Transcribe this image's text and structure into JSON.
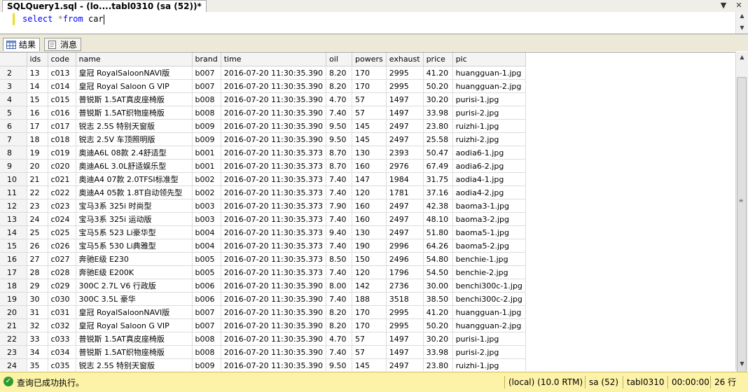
{
  "doc_tab": {
    "title": "SQLQuery1.sql - (lo....tabl0310 (sa (52))*"
  },
  "editor": {
    "kw_select": "select",
    "op_star": "*",
    "kw_from": "from",
    "table": "car"
  },
  "result_tabs": [
    {
      "label": "结果"
    },
    {
      "label": "消息"
    }
  ],
  "grid": {
    "columns": [
      "ids",
      "code",
      "name",
      "brand",
      "time",
      "oil",
      "powers",
      "exhaust",
      "price",
      "pic"
    ],
    "rows": [
      [
        "2",
        "13",
        "c013",
        "皇冠 RoyalSaloonNAVI版",
        "b007",
        "2016-07-20 11:30:35.390",
        "8.20",
        "170",
        "2995",
        "41.20",
        "huangguan-1.jpg"
      ],
      [
        "3",
        "14",
        "c014",
        "皇冠 Royal Saloon G VIP",
        "b007",
        "2016-07-20 11:30:35.390",
        "8.20",
        "170",
        "2995",
        "50.20",
        "huangguan-2.jpg"
      ],
      [
        "4",
        "15",
        "c015",
        "普锐斯 1.5AT真皮座椅版",
        "b008",
        "2016-07-20 11:30:35.390",
        "4.70",
        "57",
        "1497",
        "30.20",
        "purisi-1.jpg"
      ],
      [
        "5",
        "16",
        "c016",
        "普锐斯 1.5AT织物座椅版",
        "b008",
        "2016-07-20 11:30:35.390",
        "7.40",
        "57",
        "1497",
        "33.98",
        "purisi-2.jpg"
      ],
      [
        "6",
        "17",
        "c017",
        "锐志 2.5S 特别天窗版",
        "b009",
        "2016-07-20 11:30:35.390",
        "9.50",
        "145",
        "2497",
        "23.80",
        "ruizhi-1.jpg"
      ],
      [
        "7",
        "18",
        "c018",
        "锐志 2.5V 车顶照明版",
        "b009",
        "2016-07-20 11:30:35.390",
        "9.50",
        "145",
        "2497",
        "25.58",
        "ruizhi-2.jpg"
      ],
      [
        "8",
        "19",
        "c019",
        "奥迪A6L 08款 2.4舒适型",
        "b001",
        "2016-07-20 11:30:35.373",
        "8.70",
        "130",
        "2393",
        "50.47",
        "aodia6-1.jpg"
      ],
      [
        "9",
        "20",
        "c020",
        "奥迪A6L 3.0L舒适娱乐型",
        "b001",
        "2016-07-20 11:30:35.373",
        "8.70",
        "160",
        "2976",
        "67.49",
        "aodia6-2.jpg"
      ],
      [
        "10",
        "21",
        "c021",
        "奥迪A4 07款 2.0TFSI标准型",
        "b002",
        "2016-07-20 11:30:35.373",
        "7.40",
        "147",
        "1984",
        "31.75",
        "aodia4-1.jpg"
      ],
      [
        "11",
        "22",
        "c022",
        "奥迪A4 05款 1.8T自动领先型",
        "b002",
        "2016-07-20 11:30:35.373",
        "7.40",
        "120",
        "1781",
        "37.16",
        "aodia4-2.jpg"
      ],
      [
        "12",
        "23",
        "c023",
        "宝马3系 325i 时尚型",
        "b003",
        "2016-07-20 11:30:35.373",
        "7.90",
        "160",
        "2497",
        "42.38",
        "baoma3-1.jpg"
      ],
      [
        "13",
        "24",
        "c024",
        "宝马3系 325i 运动版",
        "b003",
        "2016-07-20 11:30:35.373",
        "7.40",
        "160",
        "2497",
        "48.10",
        "baoma3-2.jpg"
      ],
      [
        "14",
        "25",
        "c025",
        "宝马5系 523 Li豪华型",
        "b004",
        "2016-07-20 11:30:35.373",
        "9.40",
        "130",
        "2497",
        "51.80",
        "baoma5-1.jpg"
      ],
      [
        "15",
        "26",
        "c026",
        "宝马5系 530 Li典雅型",
        "b004",
        "2016-07-20 11:30:35.373",
        "7.40",
        "190",
        "2996",
        "64.26",
        "baoma5-2.jpg"
      ],
      [
        "16",
        "27",
        "c027",
        "奔驰E级 E230",
        "b005",
        "2016-07-20 11:30:35.373",
        "8.50",
        "150",
        "2496",
        "54.80",
        "benchie-1.jpg"
      ],
      [
        "17",
        "28",
        "c028",
        "奔驰E级 E200K",
        "b005",
        "2016-07-20 11:30:35.373",
        "7.40",
        "120",
        "1796",
        "54.50",
        "benchie-2.jpg"
      ],
      [
        "18",
        "29",
        "c029",
        "300C 2.7L V6 行政版",
        "b006",
        "2016-07-20 11:30:35.390",
        "8.00",
        "142",
        "2736",
        "30.00",
        "benchi300c-1.jpg"
      ],
      [
        "19",
        "30",
        "c030",
        "300C 3.5L 豪华",
        "b006",
        "2016-07-20 11:30:35.390",
        "7.40",
        "188",
        "3518",
        "38.50",
        "benchi300c-2.jpg"
      ],
      [
        "20",
        "31",
        "c031",
        "皇冠 RoyalSaloonNAVI版",
        "b007",
        "2016-07-20 11:30:35.390",
        "8.20",
        "170",
        "2995",
        "41.20",
        "huangguan-1.jpg"
      ],
      [
        "21",
        "32",
        "c032",
        "皇冠 Royal Saloon G VIP",
        "b007",
        "2016-07-20 11:30:35.390",
        "8.20",
        "170",
        "2995",
        "50.20",
        "huangguan-2.jpg"
      ],
      [
        "22",
        "33",
        "c033",
        "普锐斯 1.5AT真皮座椅版",
        "b008",
        "2016-07-20 11:30:35.390",
        "4.70",
        "57",
        "1497",
        "30.20",
        "purisi-1.jpg"
      ],
      [
        "23",
        "34",
        "c034",
        "普锐斯 1.5AT织物座椅版",
        "b008",
        "2016-07-20 11:30:35.390",
        "7.40",
        "57",
        "1497",
        "33.98",
        "purisi-2.jpg"
      ],
      [
        "24",
        "35",
        "c035",
        "锐志 2.5S 特别天窗版",
        "b009",
        "2016-07-20 11:30:35.390",
        "9.50",
        "145",
        "2497",
        "23.80",
        "ruizhi-1.jpg"
      ]
    ]
  },
  "status": {
    "message": "查询已成功执行。",
    "server": "(local) (10.0 RTM)",
    "user": "sa (52)",
    "database": "tabl0310",
    "elapsed": "00:00:00",
    "rows": "26 行"
  },
  "colors": {
    "status_bg": "#fdf3a8",
    "keyword": "#0000ff",
    "ok": "#2e9b2e"
  }
}
